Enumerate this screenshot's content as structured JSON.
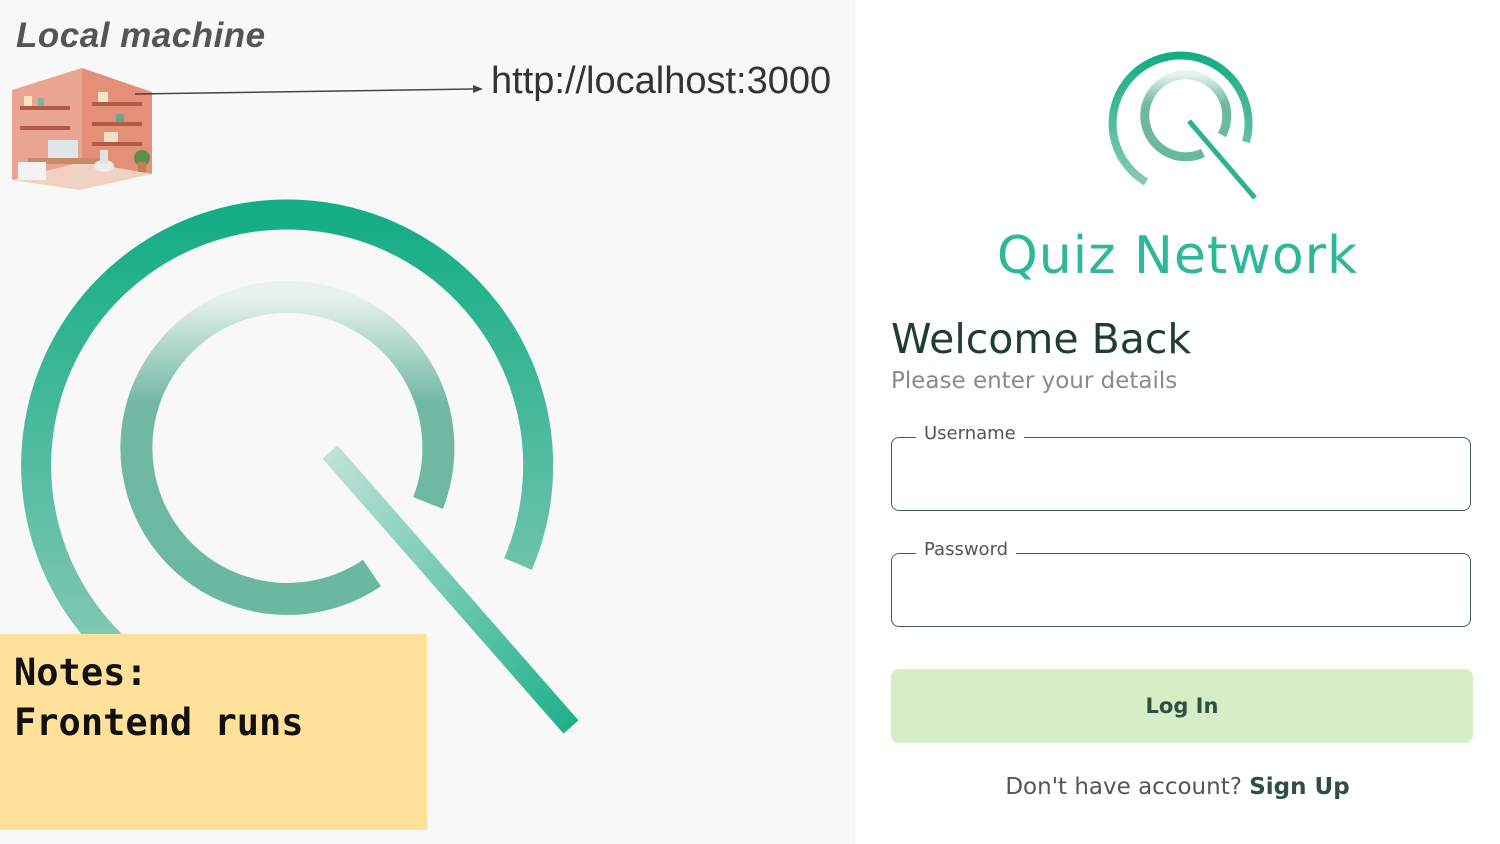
{
  "left_panel": {
    "title": "Local machine",
    "url": "http://localhost:3000",
    "notes": {
      "line1": "Notes:",
      "line2": "Frontend runs"
    }
  },
  "login": {
    "brand": "Quiz Network",
    "heading": "Welcome Back",
    "subheading": "Please enter your details",
    "username": {
      "label": "Username",
      "value": ""
    },
    "password": {
      "label": "Password",
      "value": ""
    },
    "submit_label": "Log In",
    "signup_prompt": "Don't have account?",
    "signup_link": "Sign Up"
  },
  "colors": {
    "brand_green": "#2fb79a",
    "login_button_bg": "#d6eec6",
    "notes_bg": "#ffe199"
  }
}
